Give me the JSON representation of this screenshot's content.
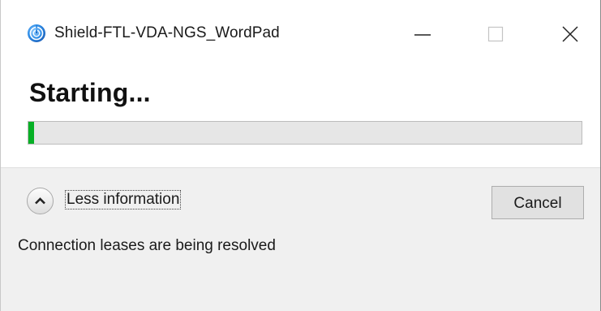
{
  "window": {
    "title": "Shield-FTL-VDA-NGS_WordPad",
    "app_icon": "citrix-receiver-icon",
    "controls": {
      "minimize": "minimize-icon",
      "maximize": "maximize-icon",
      "close": "close-icon"
    }
  },
  "main": {
    "heading": "Starting...",
    "progress": {
      "value_percent": 1,
      "fill_color": "#06b025"
    }
  },
  "details": {
    "toggle_label": "Less information",
    "toggle_icon": "chevron-up-icon",
    "cancel_label": "Cancel",
    "status_message": "Connection leases are being resolved"
  },
  "colors": {
    "progress_green": "#06b025",
    "panel_background": "#f0f0f0",
    "button_background": "#e1e1e1"
  }
}
